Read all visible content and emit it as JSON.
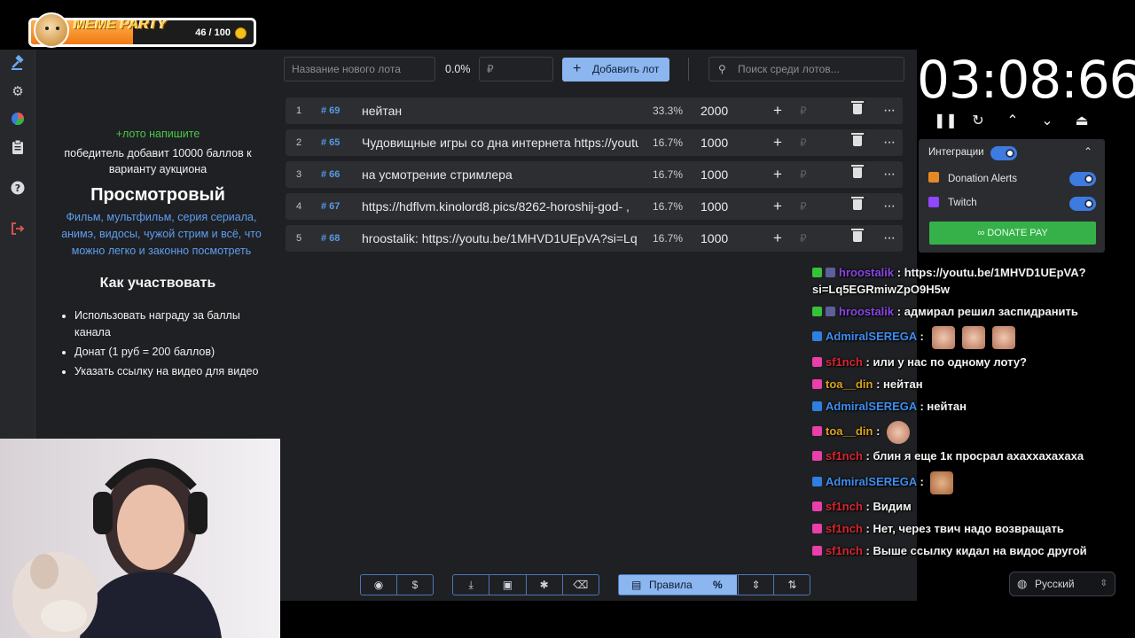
{
  "meme_party": {
    "title": "MEME PARTY",
    "count": "46 / 100",
    "progress": 0.46
  },
  "info": {
    "hint_green": "+лото напишите",
    "hint_white": "победитель добавит 10000 баллов к варианту аукциона",
    "title": "Просмотровый",
    "subtitle": "Фильм, мультфильм, серия сериала, анимэ, видосы, чужой стрим и всё, что можно легко и законно посмотреть",
    "participate_title": "Как участвовать",
    "rules": [
      "Использовать награду за баллы канала",
      "Донат (1 руб = 200 баллов)",
      "Указать ссылку на видео для видео"
    ]
  },
  "controls": {
    "lot_name_placeholder": "Название нового лота",
    "percent": "0.0%",
    "amount_placeholder": "₽",
    "add_lot_label": "Добавить лот",
    "search_placeholder": "Поиск среди лотов..."
  },
  "lots": [
    {
      "index": "1",
      "tag": "# 69",
      "name": "нейтан",
      "percent": "33.3%",
      "amount": "2000"
    },
    {
      "index": "2",
      "tag": "# 65",
      "name": "Чудовищные игры со дна интернета https://youtu",
      "percent": "16.7%",
      "amount": "1000"
    },
    {
      "index": "3",
      "tag": "# 66",
      "name": " на усмотрение стримлера",
      "percent": "16.7%",
      "amount": "1000"
    },
    {
      "index": "4",
      "tag": "# 67",
      "name": "https://hdflvm.kinolord8.pics/8262-horoshij-god- ,",
      "percent": "16.7%",
      "amount": "1000"
    },
    {
      "index": "5",
      "tag": "# 68",
      "name": "hroostalik: https://youtu.be/1MHVD1UEpVA?si=Lq",
      "percent": "16.7%",
      "amount": "1000"
    }
  ],
  "lot_actions": {
    "plus": "+",
    "rub": "₽",
    "more": "···"
  },
  "timer": "03:08:66",
  "integration": {
    "label": "Интеграции",
    "donation_alerts": "Donation Alerts",
    "twitch": "Twitch",
    "donate_pay": "DONATE PAY"
  },
  "chat": [
    {
      "user": "hroostalik",
      "color": "#8a45e6",
      "text": ": https://youtu.be/1MHVD1UEpVA?",
      "text2": "si=Lq5EGRmiwZpO9H5w"
    },
    {
      "user": "hroostalik",
      "color": "#8a45e6",
      "text": ": адмирал решил заспидранить"
    },
    {
      "user": "AdmiralSEREGA",
      "color": "#3d8ef0",
      "text": ":"
    },
    {
      "user": "sf1nch",
      "color": "#d8262f",
      "text": ": или у нас по одному лоту?"
    },
    {
      "user": "toa__din",
      "color": "#d9a21b",
      "text": ": нейтан"
    },
    {
      "user": "AdmiralSEREGA",
      "color": "#3d8ef0",
      "text": ": нейтан"
    },
    {
      "user": "toa__din",
      "color": "#d9a21b",
      "text": ":"
    },
    {
      "user": "sf1nch",
      "color": "#d8262f",
      "text": ": блин я еще 1к просрал ахаххахахаха"
    },
    {
      "user": "AdmiralSEREGA",
      "color": "#3d8ef0",
      "text": ":"
    },
    {
      "user": "sf1nch",
      "color": "#d8262f",
      "text": ": Видим"
    },
    {
      "user": "sf1nch",
      "color": "#d8262f",
      "text": ": Нет, через твич надо возвращать"
    },
    {
      "user": "sf1nch",
      "color": "#d8262f",
      "text": ": Выше ссылку кидал на видос другой"
    }
  ],
  "toolbar": {
    "rules_label": "Правила",
    "percent_icon": "%",
    "dollar_icon": "$"
  },
  "language": "Русский"
}
